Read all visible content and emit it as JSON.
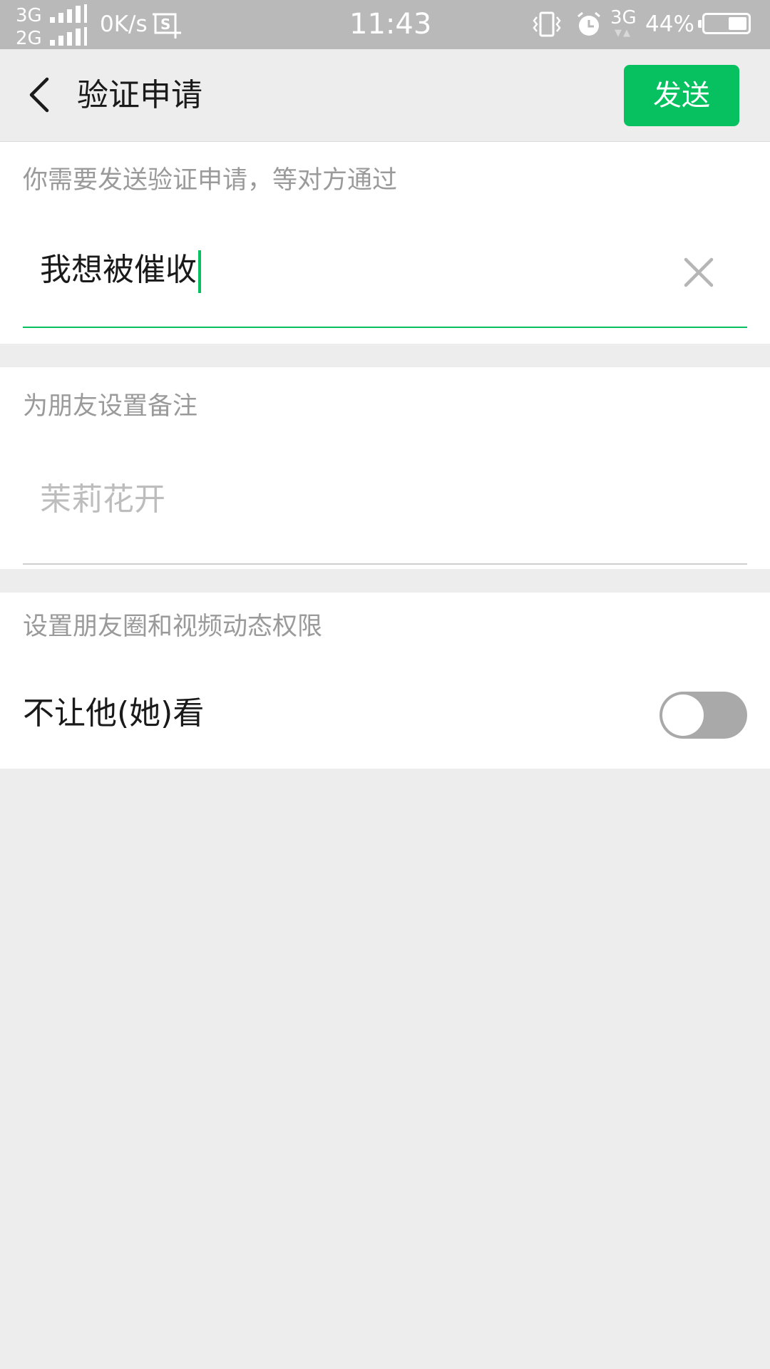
{
  "status_bar": {
    "network_1": "3G",
    "network_2": "2G",
    "net_speed": "0K/s",
    "time": "11:43",
    "mobile_data": "3G",
    "battery_percent": "44%",
    "battery_level": 0.44,
    "icons": [
      "signal-icon",
      "screenshot-icon",
      "vibrate-icon",
      "alarm-icon",
      "battery-icon"
    ]
  },
  "header": {
    "title": "验证申请",
    "send_label": "发送",
    "back_icon": "chevron-left-icon"
  },
  "verification": {
    "hint": "你需要发送验证申请，等对方通过",
    "message_value": "我想被催收",
    "clear_icon": "close-icon"
  },
  "remark": {
    "hint": "为朋友设置备注",
    "placeholder": "茉莉花开"
  },
  "permissions": {
    "hint": "设置朋友圈和视频动态权限",
    "hide_from_label": "不让他(她)看",
    "hide_from_enabled": false
  },
  "colors": {
    "accent": "#07c160",
    "background": "#ededed",
    "status_bar": "#b9b9b9",
    "toggle_off": "#a9a9a9"
  }
}
